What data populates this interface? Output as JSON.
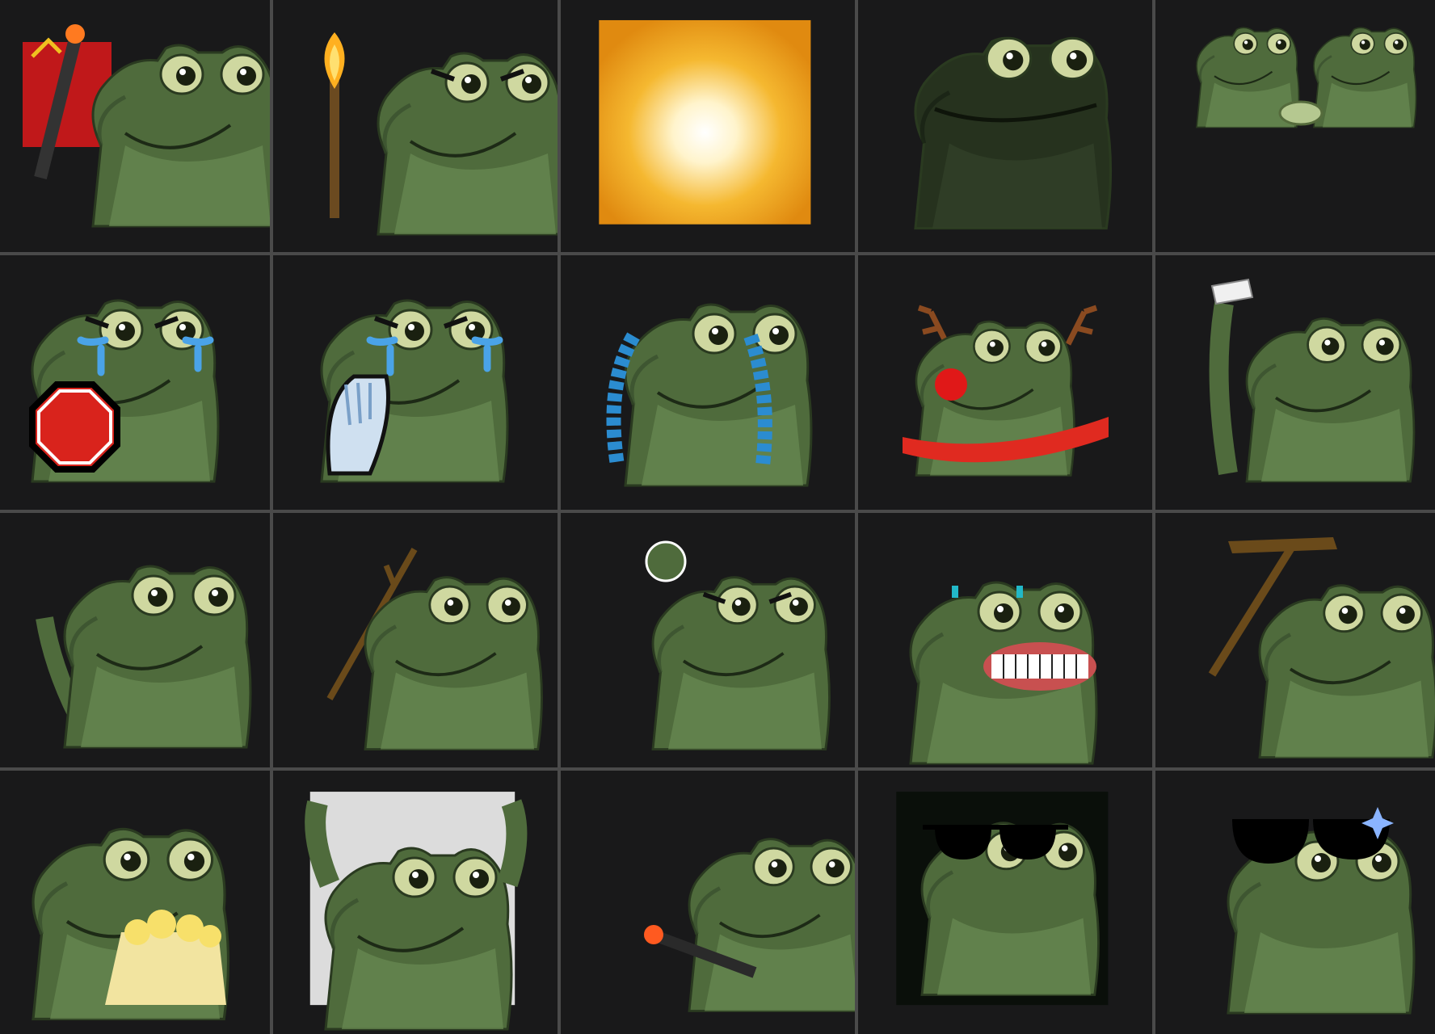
{
  "emote_grid": {
    "columns": 5,
    "rows": 4,
    "colors": {
      "tile_background": "#19191a",
      "grid_line": "#4a4a4a",
      "frog_green": "#4f6b3c",
      "frog_shadow": "#34482a",
      "frog_belly": "#6a8a52",
      "eye_white": "#cfd8a0"
    },
    "emotes": [
      {
        "icon": "frog-with-rifle-and-flag-icon"
      },
      {
        "icon": "frog-angry-holding-torch-icon"
      },
      {
        "icon": "glowing-sun-icon"
      },
      {
        "icon": "dark-frog-smug-icon"
      },
      {
        "icon": "two-frogs-handshake-icon"
      },
      {
        "icon": "frog-crying-stop-sign-icon"
      },
      {
        "icon": "frog-crying-waving-hand-icon"
      },
      {
        "icon": "frog-crying-rivers-icon"
      },
      {
        "icon": "frog-reindeer-scarf-icon"
      },
      {
        "icon": "frog-waving-white-flag-icon"
      },
      {
        "icon": "frog-waving-hand-icon"
      },
      {
        "icon": "frog-holding-stick-icon"
      },
      {
        "icon": "frog-angry-fist-icon"
      },
      {
        "icon": "frog-crying-grinning-teeth-icon"
      },
      {
        "icon": "frog-with-pickaxe-icon"
      },
      {
        "icon": "frog-eating-popcorn-icon"
      },
      {
        "icon": "frog-hands-up-icon"
      },
      {
        "icon": "frog-firing-rifle-icon"
      },
      {
        "icon": "frog-sunglasses-matrix-icon"
      },
      {
        "icon": "frog-sunglasses-sparkle-icon"
      }
    ]
  }
}
